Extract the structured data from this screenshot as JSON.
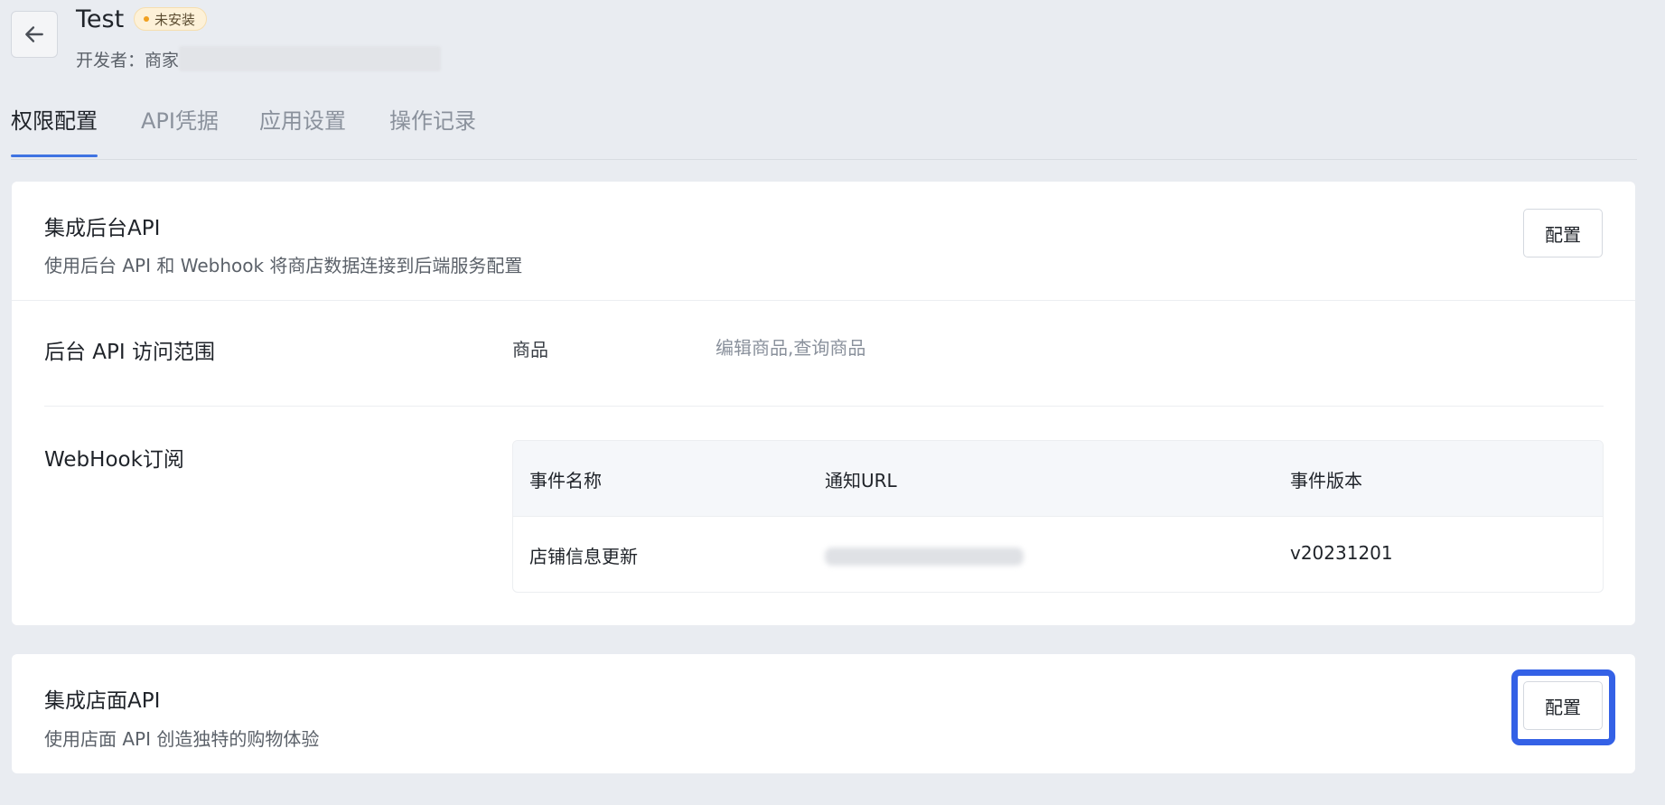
{
  "header": {
    "back_icon": "arrow-left-icon",
    "app_name": "Test",
    "status": "未安装",
    "status_color": "#f0a020",
    "developer_label": "开发者：商家"
  },
  "tabs": [
    {
      "label": "权限配置",
      "active": true
    },
    {
      "label": "API凭据",
      "active": false
    },
    {
      "label": "应用设置",
      "active": false
    },
    {
      "label": "操作记录",
      "active": false
    }
  ],
  "accent_color": "#3f73e2",
  "backend_api": {
    "title": "集成后台API",
    "description": "使用后台 API 和 Webhook 将商店数据连接到后端服务配置",
    "configure_label": "配置",
    "scope": {
      "label": "后台 API 访问范围",
      "name": "商品",
      "value": "编辑商品,查询商品"
    },
    "webhook": {
      "label": "WebHook订阅",
      "columns": [
        "事件名称",
        "通知URL",
        "事件版本"
      ],
      "rows": [
        {
          "event": "店铺信息更新",
          "version": "v20231201"
        }
      ]
    }
  },
  "storefront_api": {
    "title": "集成店面API",
    "description": "使用店面 API 创造独特的购物体验",
    "configure_label": "配置"
  }
}
